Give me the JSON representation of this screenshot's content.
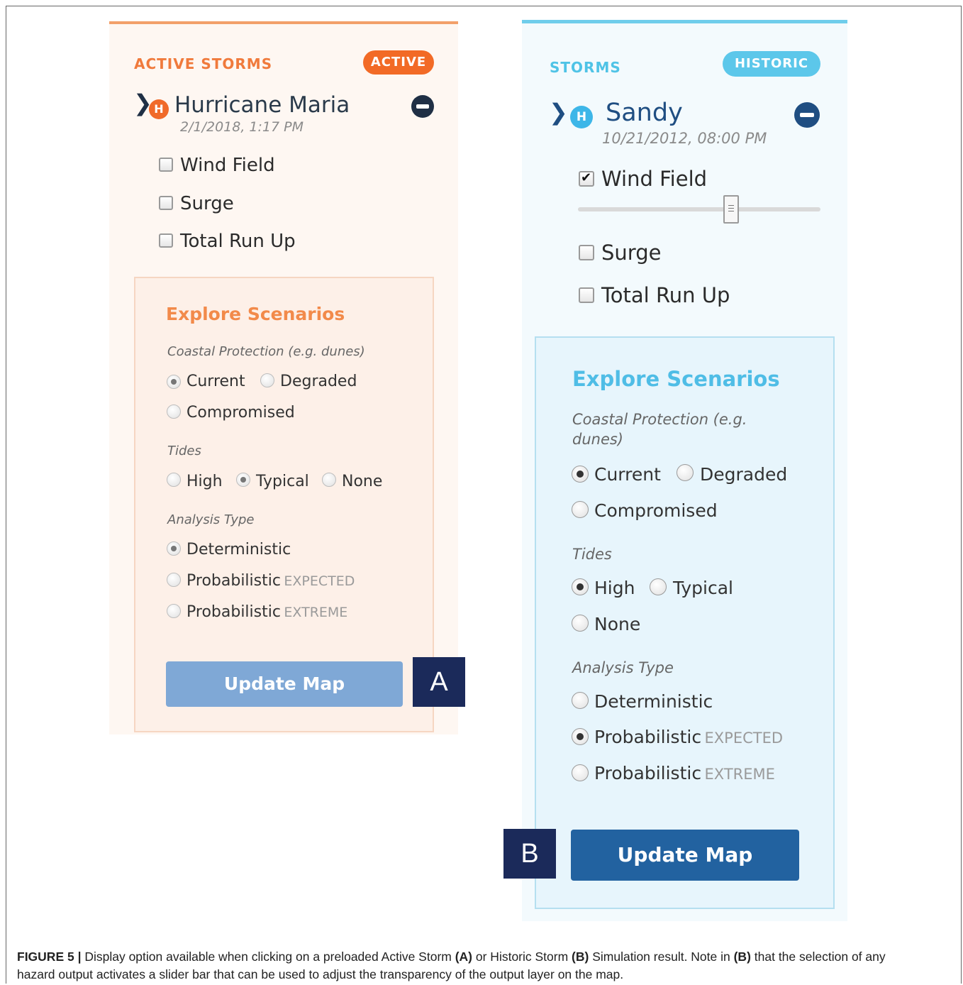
{
  "panel_a": {
    "header_title": "ACTIVE STORMS",
    "badge": "ACTIVE",
    "storm_badge": "H",
    "storm_name": "Hurricane Maria",
    "storm_date": "2/1/2018, 1:17 PM",
    "layers": [
      {
        "label": "Wind Field",
        "checked": false
      },
      {
        "label": "Surge",
        "checked": false
      },
      {
        "label": "Total Run Up",
        "checked": false
      }
    ],
    "scenarios": {
      "title": "Explore Scenarios",
      "coastal_label": "Coastal Protection (e.g. dunes)",
      "coastal_options": [
        "Current",
        "Degraded",
        "Compromised"
      ],
      "coastal_selected": "Current",
      "tides_label": "Tides",
      "tides_options": [
        "High",
        "Typical",
        "None"
      ],
      "tides_selected": "Typical",
      "analysis_label": "Analysis Type",
      "analysis_options": [
        "Deterministic",
        "Probabilistic",
        "Probabilistic"
      ],
      "analysis_suffixes": [
        "",
        "EXPECTED",
        "EXTREME"
      ],
      "analysis_selected": "Deterministic"
    },
    "update_button": "Update Map",
    "tag": "A"
  },
  "panel_b": {
    "header_title": "STORMS",
    "badge": "HISTORIC",
    "storm_badge": "H",
    "storm_name": "Sandy",
    "storm_date": "10/21/2012, 08:00 PM",
    "layers": [
      {
        "label": "Wind Field",
        "checked": true
      },
      {
        "label": "Surge",
        "checked": false
      },
      {
        "label": "Total Run Up",
        "checked": false
      }
    ],
    "transparency_slider": 0.64,
    "scenarios": {
      "title": "Explore Scenarios",
      "coastal_label_line1": "Coastal Protection (e.g.",
      "coastal_label_line2": "dunes)",
      "coastal_options": [
        "Current",
        "Degraded",
        "Compromised"
      ],
      "coastal_selected": "Current",
      "tides_label": "Tides",
      "tides_options": [
        "High",
        "Typical",
        "None"
      ],
      "tides_selected": "High",
      "analysis_label": "Analysis Type",
      "analysis_options": [
        "Deterministic",
        "Probabilistic",
        "Probabilistic"
      ],
      "analysis_suffixes": [
        "",
        "EXPECTED",
        "EXTREME"
      ],
      "analysis_selected": "Probabilistic EXPECTED"
    },
    "update_button": "Update Map",
    "tag": "B"
  },
  "caption": {
    "label": "FIGURE 5 |",
    "t1": " Display option available when clicking on a preloaded Active Storm ",
    "a": "(A)",
    "t2": " or Historic Storm ",
    "b1": "(B)",
    "t3": " Simulation result. Note in ",
    "b2": "(B)",
    "t4": " that the selection of any",
    "line2": "hazard output activates a slider bar that can be used to adjust the transparency of the output layer on the map."
  },
  "colors": {
    "orange_accent": "#f07a3c",
    "orange_top_border": "#f2a06a",
    "blue_accent": "#4fc3e6",
    "update_button_a": "#7fa8d6",
    "update_button_b": "#2262a0",
    "tag_bg": "#1b2a5a",
    "storm_badge_a": "#f06a2a",
    "storm_badge_b": "#3db6e8"
  },
  "icons": {
    "expand": "chevron-right-icon",
    "remove": "minus-circle-icon",
    "hurricane": "hurricane-badge-icon"
  }
}
